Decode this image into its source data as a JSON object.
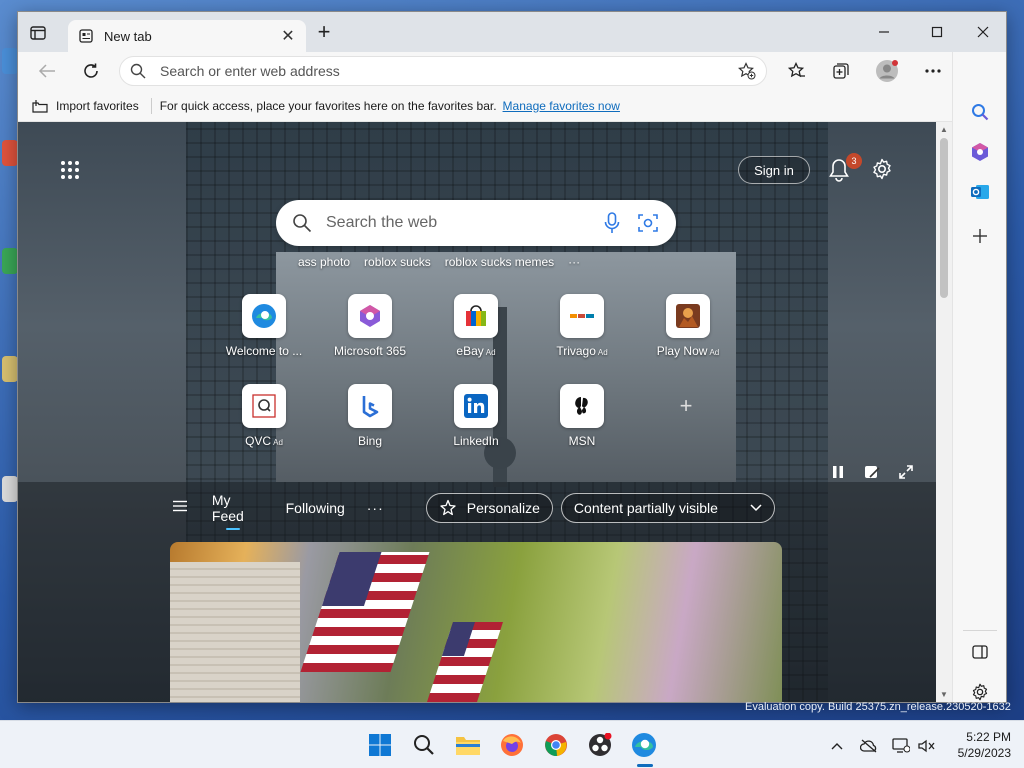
{
  "browser": {
    "tab": {
      "title": "New tab"
    },
    "address_bar": {
      "placeholder": "Search or enter web address"
    },
    "favorites_bar": {
      "import_label": "Import favorites",
      "message": "For quick access, place your favorites here on the favorites bar.",
      "manage_link": "Manage favorites now"
    }
  },
  "new_tab_page": {
    "sign_in_label": "Sign in",
    "notification_count": "3",
    "search": {
      "placeholder": "Search the web"
    },
    "suggestions": [
      "ass photo",
      "roblox sucks",
      "roblox sucks memes"
    ],
    "quick_links": [
      {
        "label": "Welcome to ...",
        "ad": ""
      },
      {
        "label": "Microsoft 365",
        "ad": ""
      },
      {
        "label": "eBay",
        "ad": "Ad"
      },
      {
        "label": "Trivago",
        "ad": "Ad"
      },
      {
        "label": "Play Now",
        "ad": "Ad"
      },
      {
        "label": "QVC",
        "ad": "Ad"
      },
      {
        "label": "Bing",
        "ad": ""
      },
      {
        "label": "LinkedIn",
        "ad": ""
      },
      {
        "label": "MSN",
        "ad": ""
      }
    ],
    "feed": {
      "tabs": [
        "My Feed",
        "Following"
      ],
      "more_label": "···",
      "personalize_label": "Personalize",
      "content_visibility": "Content partially visible"
    }
  },
  "desktop": {
    "watermark": "Evaluation copy. Build 25375.zn_release.230520-1632"
  },
  "taskbar": {
    "time": "5:22 PM",
    "date": "5/29/2023"
  },
  "colors": {
    "accent": "#0f6cbd",
    "badge": "#c4482b",
    "feed_underline": "#4cc2ff"
  }
}
